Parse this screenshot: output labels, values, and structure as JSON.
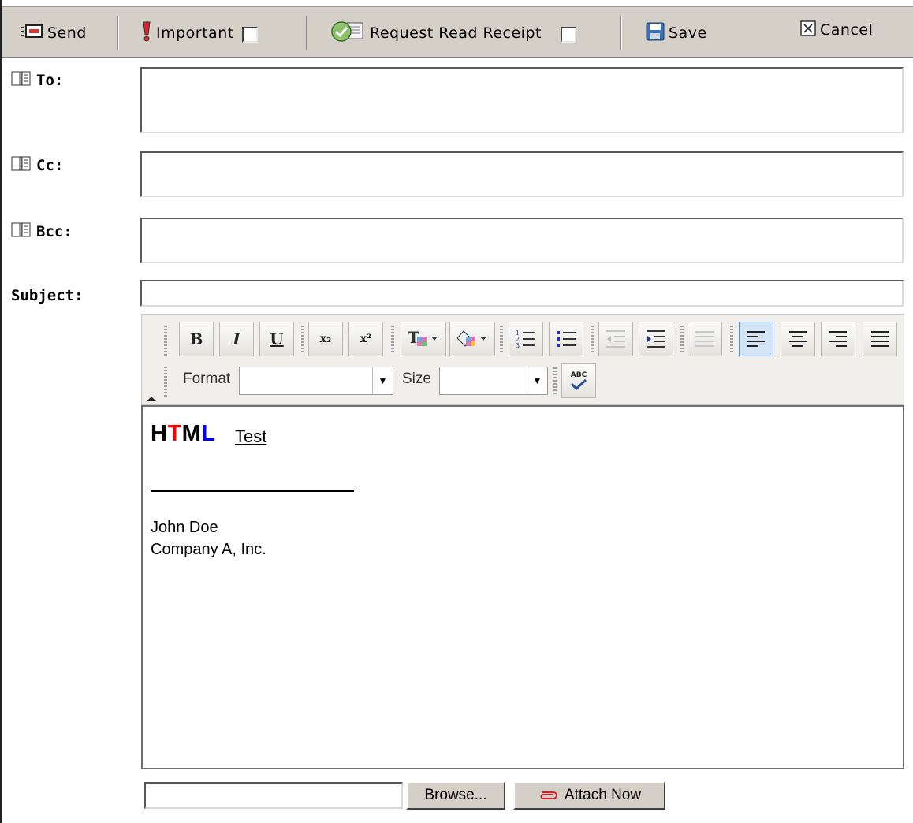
{
  "toolbar": {
    "send": "Send",
    "important": "Important",
    "read_receipt": "Request Read Receipt",
    "save": "Save",
    "cancel": "Cancel"
  },
  "fields": {
    "to_label": "To:",
    "cc_label": "Cc:",
    "bcc_label": "Bcc:",
    "subject_label": "Subject:",
    "to_value": "",
    "cc_value": "",
    "bcc_value": "",
    "subject_value": ""
  },
  "editor": {
    "format_label": "Format",
    "size_label": "Size",
    "format_value": "",
    "size_value": "",
    "buttons": {
      "bold": "B",
      "italic": "I",
      "underline": "U",
      "subscript": "x₂",
      "superscript": "x²",
      "spellcheck": "ABC"
    }
  },
  "content": {
    "title_parts": [
      "H",
      "T",
      "M",
      "L"
    ],
    "title_colors": [
      "#000000",
      "#ff0000",
      "#000000",
      "#0000ff"
    ],
    "test_text": "Test",
    "signature_name": "John Doe",
    "signature_company": "Company A, Inc."
  },
  "attach": {
    "browse": "Browse...",
    "attach_now": "Attach Now",
    "file_value": ""
  }
}
